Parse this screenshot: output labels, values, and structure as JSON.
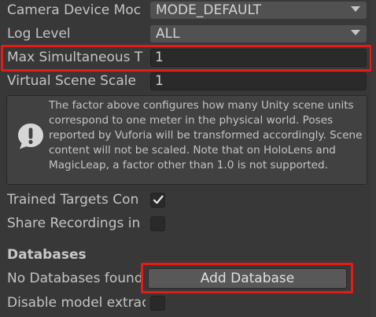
{
  "rows": {
    "camera_device_mode": {
      "label": "Camera Device Moc",
      "value": "MODE_DEFAULT"
    },
    "log_level": {
      "label": "Log Level",
      "value": "ALL"
    },
    "max_simultaneous": {
      "label": "Max Simultaneous T",
      "value": "1"
    },
    "virtual_scene_scale": {
      "label": "Virtual Scene Scale",
      "value": "1"
    }
  },
  "help": {
    "icon": "exclamation-icon",
    "text": "The factor above configures how many Unity scene units correspond to one meter in the physical world. Poses reported by Vuforia will be transformed accordingly. Scene content will not be scaled. Note that on HoloLens and MagicLeap, a factor other than 1.0 is not supported."
  },
  "toggles": {
    "trained_targets": {
      "label": "Trained Targets Con",
      "checked": true
    },
    "share_recordings": {
      "label": "Share Recordings in",
      "checked": false
    },
    "disable_model_extraction": {
      "label": "Disable model extrac",
      "checked": false
    }
  },
  "databases": {
    "title": "Databases",
    "empty_label": "No Databases found",
    "add_button_label": "Add Database"
  },
  "colors": {
    "background": "#383838",
    "highlight": "#e41b17",
    "field_bg": "#2a2a2a",
    "dropdown_bg": "#515151",
    "button_bg": "#585858"
  }
}
